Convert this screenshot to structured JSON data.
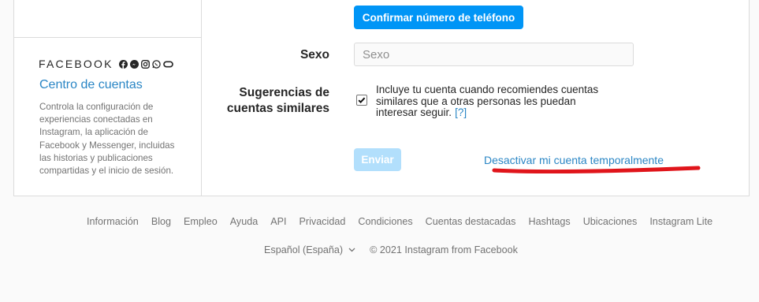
{
  "sidebar": {
    "brand": "FACEBOOK",
    "brand_icons": [
      "facebook-icon",
      "messenger-icon",
      "instagram-icon",
      "whatsapp-icon",
      "oculus-icon"
    ],
    "title": "Centro de cuentas",
    "description": "Controla la configuración de experiencias conectadas en Instagram, la aplicación de Facebook y Messenger, incluidas las historias y publicaciones compartidas y el inicio de sesión."
  },
  "form": {
    "confirm_phone_label": "Confirmar número de teléfono",
    "sexo_label": "Sexo",
    "sexo_placeholder": "Sexo",
    "suggestions_label": "Sugerencias de cuentas similares",
    "suggestions_checked": true,
    "suggestions_text": "Incluye tu cuenta cuando recomiendes cuentas similares que a otras personas les puedan interesar seguir.",
    "help_link": "[?]",
    "submit_label": "Enviar",
    "deactivate_label": "Desactivar mi cuenta temporalmente"
  },
  "footer": {
    "links": [
      "Información",
      "Blog",
      "Empleo",
      "Ayuda",
      "API",
      "Privacidad",
      "Condiciones",
      "Cuentas destacadas",
      "Hashtags",
      "Ubicaciones",
      "Instagram Lite"
    ],
    "language": "Español (España)",
    "copyright": "© 2021 Instagram from Facebook"
  },
  "colors": {
    "primary_button": "#0095f6",
    "disabled_button": "#b2dffc",
    "link": "#2a86c5",
    "annotation_red": "#e0151b"
  }
}
